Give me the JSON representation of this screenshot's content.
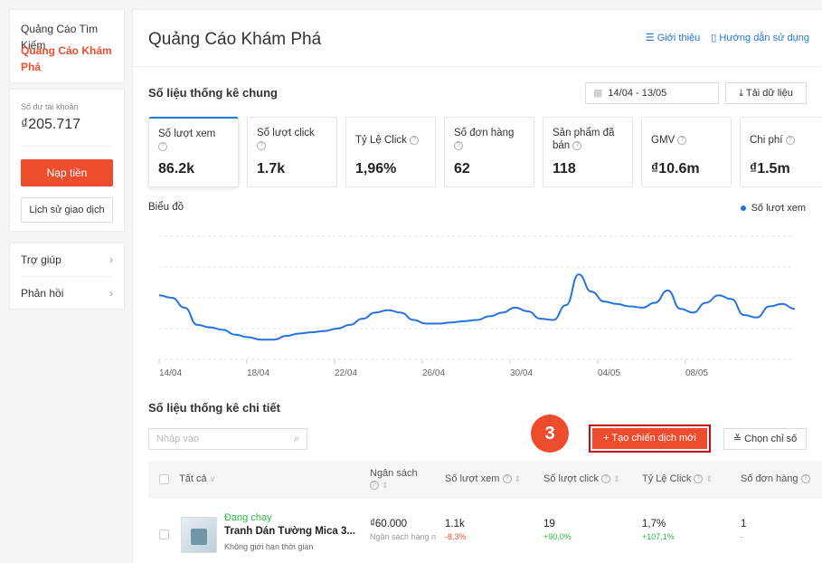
{
  "sidebar": {
    "nav": [
      "Quảng Cáo Tìm Kiếm",
      "Quảng Cáo Khám Phá"
    ],
    "balance_label": "Số dư tài khoản",
    "balance_value": "₫205.717",
    "topup_label": "Nạp tiền",
    "history_label": "Lịch sử giao dịch",
    "help": [
      "Trợ giúp",
      "Phản hồi"
    ]
  },
  "header": {
    "title": "Quảng Cáo Khám Phá",
    "intro_link": "Giới thiệu",
    "guide_link": "Hướng dẫn sử dụng"
  },
  "overview": {
    "title": "Số liệu thống kê chung",
    "date_range": "14/04 - 13/05",
    "download_label": "Tải dữ liệu",
    "metrics": [
      {
        "label": "Số lượt xem",
        "value": "86.2k"
      },
      {
        "label": "Số lượt click",
        "value": "1.7k"
      },
      {
        "label": "Tỷ Lệ Click",
        "value": "1,96%"
      },
      {
        "label": "Số đơn hàng",
        "value": "62"
      },
      {
        "label": "Sản phẩm đã bán",
        "value": "118"
      },
      {
        "label": "GMV",
        "value": "₫10.6m"
      },
      {
        "label": "Chi phí",
        "value": "₫1.5m"
      }
    ]
  },
  "chart_data": {
    "type": "line",
    "title": "Biểu đồ",
    "x_ticks": [
      "14/04",
      "18/04",
      "22/04",
      "26/04",
      "30/04",
      "04/05",
      "08/05"
    ],
    "series": [
      {
        "name": "Số lượt xem",
        "color": "#2673dd",
        "values": [
          0.52,
          0.5,
          0.42,
          0.28,
          0.26,
          0.24,
          0.2,
          0.18,
          0.16,
          0.16,
          0.19,
          0.21,
          0.22,
          0.23,
          0.25,
          0.28,
          0.33,
          0.38,
          0.4,
          0.38,
          0.32,
          0.29,
          0.29,
          0.3,
          0.31,
          0.32,
          0.35,
          0.38,
          0.42,
          0.39,
          0.33,
          0.32,
          0.44,
          0.69,
          0.55,
          0.47,
          0.45,
          0.43,
          0.42,
          0.46,
          0.56,
          0.41,
          0.38,
          0.46,
          0.52,
          0.49,
          0.36,
          0.34,
          0.43,
          0.45,
          0.41
        ]
      }
    ],
    "grid": true,
    "legend": "top-right"
  },
  "detail": {
    "title": "Số liệu thống kê chi tiết",
    "search_placeholder": "Nhập vào",
    "step_number": "3",
    "new_campaign_label": "+ Tạo chiến dịch mới",
    "choose_metrics_label": "Chọn chỉ số",
    "columns": {
      "all": "Tất cả",
      "budget": "Ngân sách",
      "views": "Số lượt xem",
      "clicks": "Số lượt click",
      "ctr": "Tỷ Lệ Click",
      "orders": "Số đơn hàng"
    },
    "row": {
      "status": "Đang chạy",
      "name": "Tranh Dán Tường Mica 3...",
      "time": "Không giới hạn thời gian",
      "budget": "₫60.000",
      "budget_sub": "Ngân sách hàng n",
      "views": "1.1k",
      "views_change": "-8,3%",
      "clicks": "19",
      "clicks_change": "+90,0%",
      "ctr": "1,7%",
      "ctr_change": "+107,1%",
      "orders": "1",
      "orders_change": "-"
    }
  }
}
